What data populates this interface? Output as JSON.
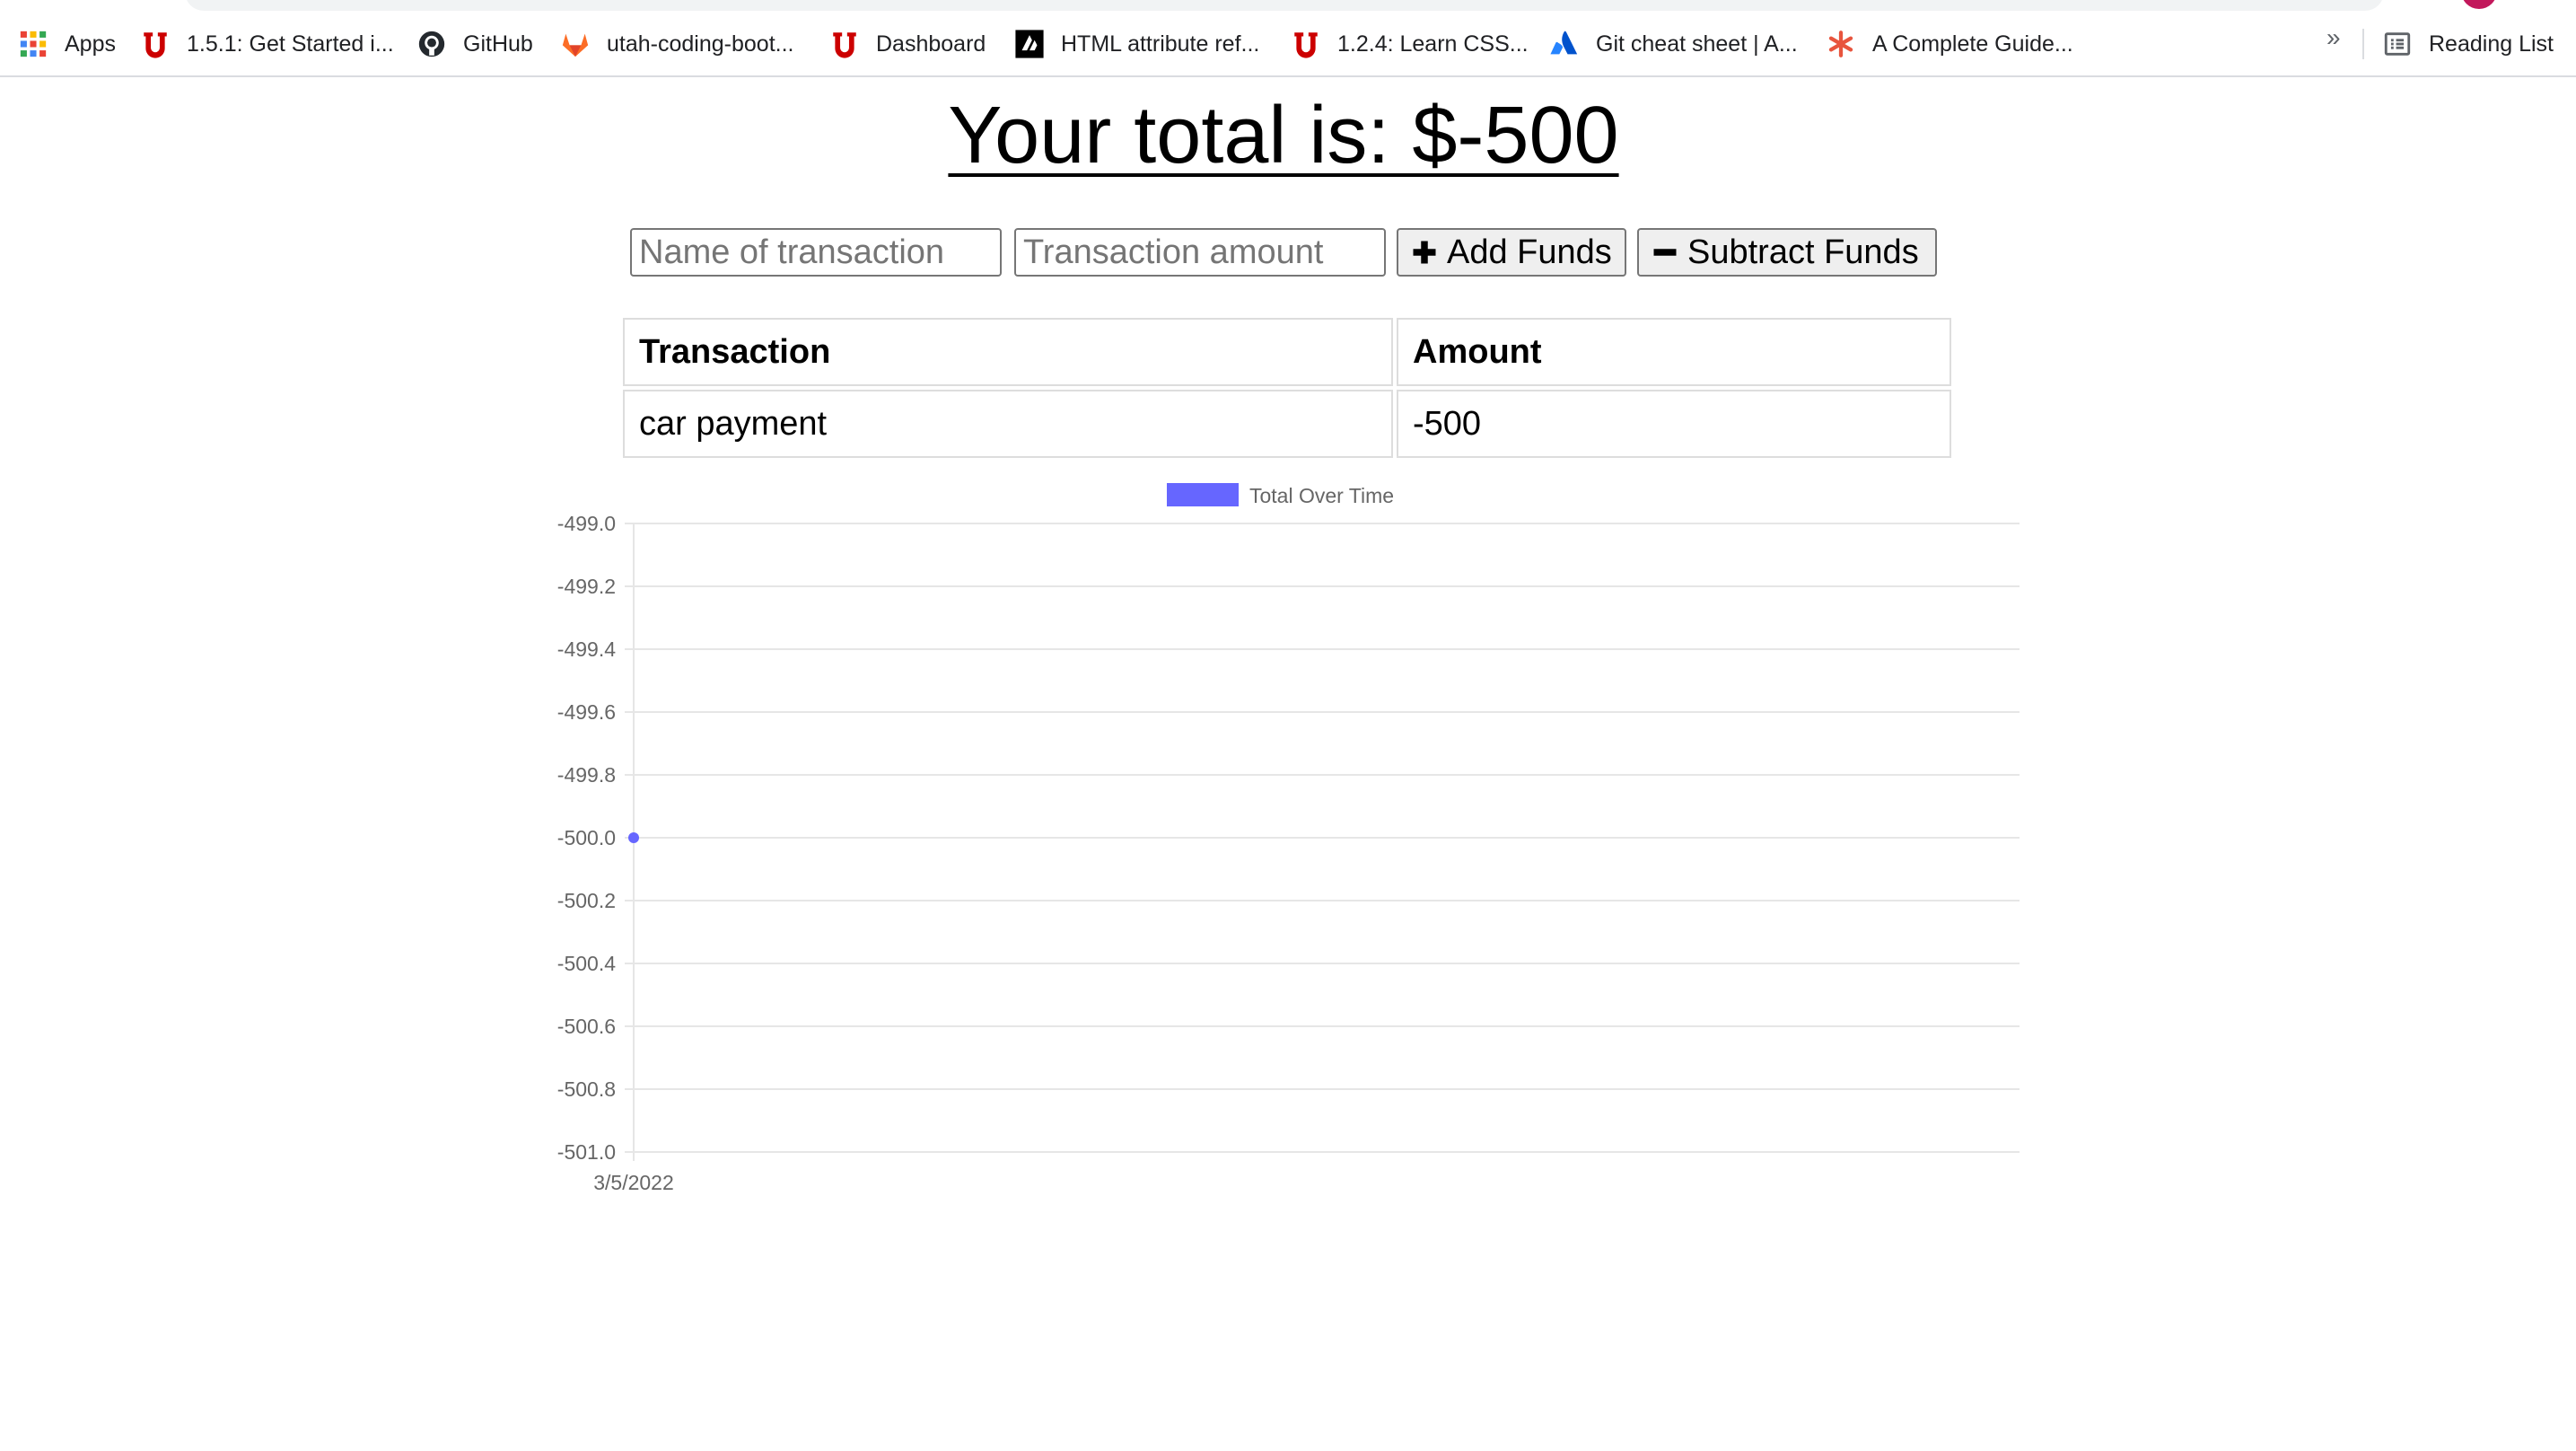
{
  "bookmarks": {
    "items": [
      {
        "label": "Apps",
        "icon": "apps-grid-icon"
      },
      {
        "label": "1.5.1: Get Started i...",
        "icon": "utah-u-icon"
      },
      {
        "label": "GitHub",
        "icon": "github-icon"
      },
      {
        "label": "utah-coding-boot...",
        "icon": "gitlab-icon"
      },
      {
        "label": "Dashboard",
        "icon": "utah-u-icon"
      },
      {
        "label": "HTML attribute ref...",
        "icon": "mdn-icon"
      },
      {
        "label": "1.2.4: Learn CSS...",
        "icon": "utah-u-icon"
      },
      {
        "label": "Git cheat sheet | A...",
        "icon": "atlassian-icon"
      },
      {
        "label": "A Complete Guide...",
        "icon": "asterisk-icon"
      }
    ],
    "more_label": "»",
    "reading_list": "Reading List"
  },
  "page": {
    "total_text": "Your total is: $-500"
  },
  "form": {
    "name_placeholder": "Name of transaction",
    "amount_placeholder": "Transaction amount",
    "add_label": "Add Funds",
    "subtract_label": "Subtract Funds"
  },
  "table": {
    "headers": [
      "Transaction",
      "Amount"
    ],
    "rows": [
      {
        "name": "car payment",
        "amount": "-500"
      }
    ]
  },
  "colors": {
    "series": "#6666ff",
    "grid": "#e6e6e6",
    "tick_text": "#666666"
  },
  "chart_data": {
    "type": "line",
    "legend_position": "top",
    "grid": true,
    "x": [
      "3/5/2022"
    ],
    "series": [
      {
        "name": "Total Over Time",
        "values": [
          -500
        ]
      }
    ],
    "ylim": [
      -501.0,
      -499.0
    ],
    "y_ticks": [
      "-499.0",
      "-499.2",
      "-499.4",
      "-499.6",
      "-499.8",
      "-500.0",
      "-500.2",
      "-500.4",
      "-500.6",
      "-500.8",
      "-501.0"
    ],
    "x_ticks": [
      "3/5/2022"
    ]
  }
}
